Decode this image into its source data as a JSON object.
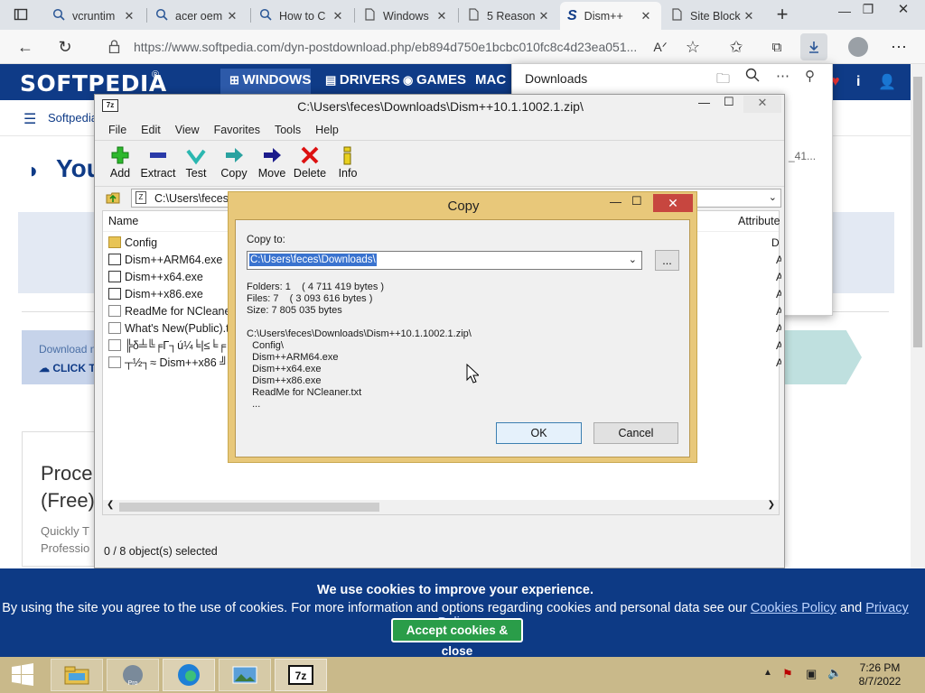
{
  "browser": {
    "tabs": [
      {
        "title": "vcruntim",
        "icon": "search-icon"
      },
      {
        "title": "acer oem",
        "icon": "search-icon"
      },
      {
        "title": "How to C",
        "icon": "search-icon"
      },
      {
        "title": "Windows",
        "icon": "document-icon"
      },
      {
        "title": "5 Reason",
        "icon": "document-icon"
      },
      {
        "title": "Dism++",
        "icon": "softpedia-icon"
      },
      {
        "title": "Site Block",
        "icon": "document-icon"
      }
    ],
    "url": "https://www.softpedia.com/dyn-postdownload.php/eb894d750e1bcbc010fc8c4d23ea051...",
    "downloads_panel": {
      "title": "Downloads",
      "item_fragment": "_41..."
    }
  },
  "softpedia": {
    "logo": "SOFTPEDIA",
    "nav": [
      "WINDOWS",
      "DRIVERS",
      "GAMES",
      "MAC"
    ],
    "breadcrumb": "Softpedia",
    "heading_fragment": "You",
    "download_label": "Download n",
    "click_label": "CLICK TO",
    "proc_title_1": "Proce",
    "proc_title_2": "(Free)",
    "proc_desc_1": "Quickly T",
    "proc_desc_2": "Professio"
  },
  "sevenzip": {
    "title": "C:\\Users\\feces\\Downloads\\Dism++10.1.1002.1.zip\\",
    "menu": [
      "File",
      "Edit",
      "View",
      "Favorites",
      "Tools",
      "Help"
    ],
    "toolbar": [
      "Add",
      "Extract",
      "Test",
      "Copy",
      "Move",
      "Delete",
      "Info"
    ],
    "path": "C:\\Users\\feces\\",
    "columns": {
      "name": "Name",
      "attributes": "Attribute"
    },
    "files": [
      {
        "name": "Config",
        "attr": "D"
      },
      {
        "name": "Dism++ARM64.exe",
        "attr": "A"
      },
      {
        "name": "Dism++x64.exe",
        "attr": "A"
      },
      {
        "name": "Dism++x86.exe",
        "attr": "A"
      },
      {
        "name": "ReadMe for NCleaner.",
        "attr": "A"
      },
      {
        "name": "What's New(Public).tx",
        "attr": "A"
      },
      {
        "name": "╠δ╧╚╒Γ┐ú¼╘|≤╘╒",
        "attr": "A"
      },
      {
        "name": "┬½┐≈ Dism++x86 ╝┐",
        "attr": "A"
      }
    ],
    "status": "0 / 8 object(s) selected"
  },
  "copy_dialog": {
    "title": "Copy",
    "copy_to_label": "Copy to:",
    "destination": "C:\\Users\\feces\\Downloads\\",
    "browse_label": "...",
    "stats": [
      "Folders: 1    ( 4 711 419 bytes )",
      "Files: 7    ( 3 093 616 bytes )",
      "Size: 7 805 035 bytes"
    ],
    "source_list": [
      "C:\\Users\\feces\\Downloads\\Dism++10.1.1002.1.zip\\",
      "  Config\\",
      "  Dism++ARM64.exe",
      "  Dism++x64.exe",
      "  Dism++x86.exe",
      "  ReadMe for NCleaner.txt",
      "  ..."
    ],
    "ok_label": "OK",
    "cancel_label": "Cancel"
  },
  "cookie_banner": {
    "headline": "We use cookies to improve your experience.",
    "text": "By using the site you agree to the use of cookies. For more information and options regarding cookies and personal data see our",
    "link1": "Cookies Policy",
    "and": "and",
    "link2": "Privacy Policy",
    "accept_label": "Accept cookies & close"
  },
  "taskbar": {
    "time": "7:26 PM",
    "date": "8/7/2022",
    "pinned": [
      "file-explorer-icon",
      "google-earth-pro-icon",
      "edge-icon",
      "photos-icon",
      "7zip-icon"
    ]
  }
}
